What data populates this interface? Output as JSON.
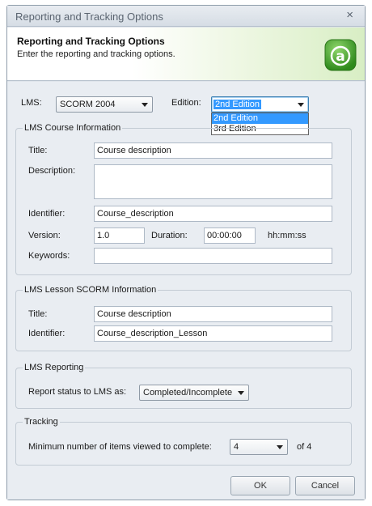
{
  "window": {
    "title": "Reporting and Tracking Options",
    "close_glyph": "×"
  },
  "banner": {
    "heading": "Reporting and Tracking Options",
    "subtitle": "Enter the reporting and tracking options.",
    "logo_icon": "app-logo-icon",
    "logo_letter": "a",
    "accent_color": "#43a62a"
  },
  "lms": {
    "label": "LMS:",
    "value": "SCORM 2004",
    "edition_label": "Edition:",
    "edition_value": "2nd Edition",
    "edition_options": [
      "2nd Edition",
      "3rd Edition"
    ]
  },
  "course_info": {
    "legend": "LMS Course Information",
    "title_label": "Title:",
    "title_value": "Course description",
    "description_label": "Description:",
    "description_value": "",
    "identifier_label": "Identifier:",
    "identifier_value": "Course_description",
    "version_label": "Version:",
    "version_value": "1.0",
    "duration_label": "Duration:",
    "duration_value": "00:00:00",
    "duration_hint": "hh:mm:ss",
    "keywords_label": "Keywords:",
    "keywords_value": ""
  },
  "lesson_info": {
    "legend": "LMS Lesson SCORM Information",
    "title_label": "Title:",
    "title_value": "Course description",
    "identifier_label": "Identifier:",
    "identifier_value": "Course_description_Lesson"
  },
  "reporting": {
    "legend": "LMS Reporting",
    "status_label": "Report status to LMS as:",
    "status_value": "Completed/Incomplete"
  },
  "tracking": {
    "legend": "Tracking",
    "min_items_label": "Minimum number of items viewed to complete:",
    "min_items_value": "4",
    "of_total": "of 4"
  },
  "buttons": {
    "ok": "OK",
    "cancel": "Cancel"
  }
}
